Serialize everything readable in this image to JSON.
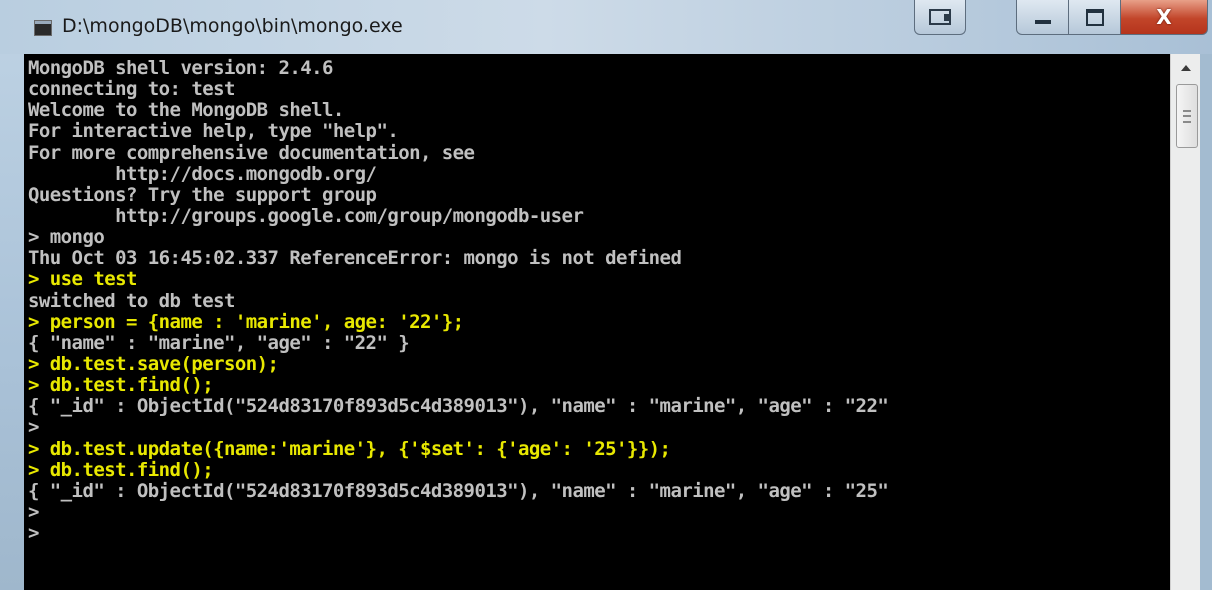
{
  "window": {
    "title": "D:\\mongoDB\\mongo\\bin\\mongo.exe",
    "icon": "console-app-icon",
    "controls": [
      "snap-icon",
      "minimize-icon",
      "maximize-icon",
      "close-icon"
    ],
    "close_glyph": "X"
  },
  "console": {
    "colors": {
      "background": "#000000",
      "normal": "#c0c0c0",
      "command": "#e8e800"
    },
    "lines": [
      {
        "text": "MongoDB shell version: 2.4.6",
        "style": "normal"
      },
      {
        "text": "connecting to: test",
        "style": "normal"
      },
      {
        "text": "Welcome to the MongoDB shell.",
        "style": "normal"
      },
      {
        "text": "For interactive help, type \"help\".",
        "style": "normal"
      },
      {
        "text": "For more comprehensive documentation, see",
        "style": "normal"
      },
      {
        "text": "        http://docs.mongodb.org/",
        "style": "normal"
      },
      {
        "text": "Questions? Try the support group",
        "style": "normal"
      },
      {
        "text": "        http://groups.google.com/group/mongodb-user",
        "style": "normal"
      },
      {
        "text": "> mongo",
        "style": "normal"
      },
      {
        "text": "Thu Oct 03 16:45:02.337 ReferenceError: mongo is not defined",
        "style": "normal"
      },
      {
        "text": "> use test",
        "style": "yellow"
      },
      {
        "text": "switched to db test",
        "style": "normal"
      },
      {
        "text": "> person = {name : 'marine', age: '22'};",
        "style": "yellow"
      },
      {
        "text": "{ \"name\" : \"marine\", \"age\" : \"22\" }",
        "style": "normal"
      },
      {
        "text": "> db.test.save(person);",
        "style": "yellow"
      },
      {
        "text": "> db.test.find();",
        "style": "yellow"
      },
      {
        "text": "{ \"_id\" : ObjectId(\"524d83170f893d5c4d389013\"), \"name\" : \"marine\", \"age\" : \"22\"",
        "style": "normal"
      },
      {
        "text": ">",
        "style": "normal"
      },
      {
        "text": "> db.test.update({name:'marine'}, {'$set': {'age': '25'}});",
        "style": "yellow"
      },
      {
        "text": "> db.test.find();",
        "style": "yellow"
      },
      {
        "text": "{ \"_id\" : ObjectId(\"524d83170f893d5c4d389013\"), \"name\" : \"marine\", \"age\" : \"25\"",
        "style": "normal"
      },
      {
        "text": ">",
        "style": "normal"
      },
      {
        "text": ">",
        "style": "normal"
      }
    ]
  },
  "scrollbar": {
    "up_arrow_icon": "chevron-up-icon",
    "thumb_grip_icon": "grip-icon"
  }
}
